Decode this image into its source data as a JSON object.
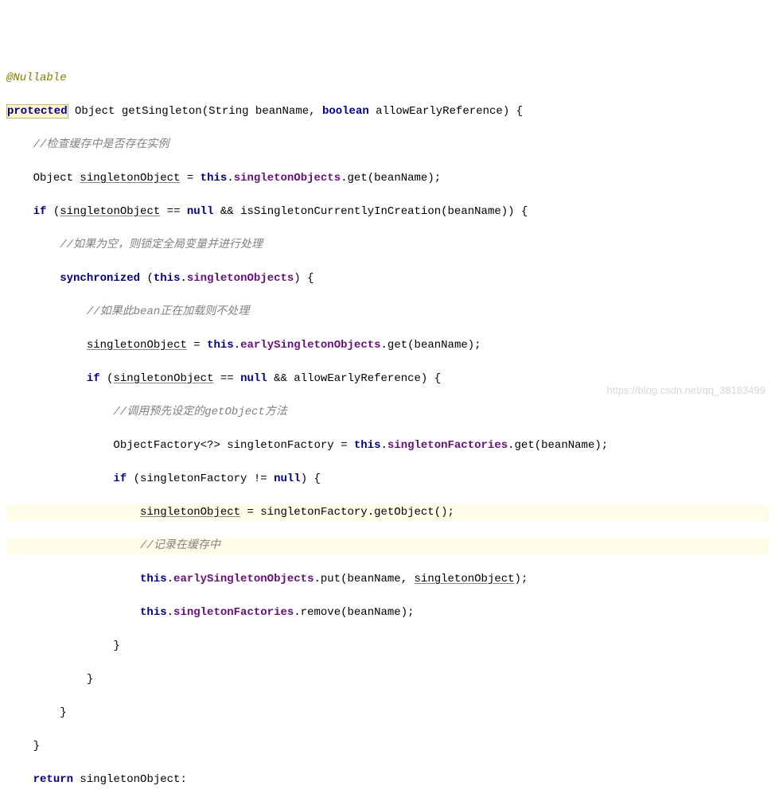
{
  "code": {
    "annotation": "@Nullable",
    "protected": "protected",
    "object": "Object",
    "method": "getSingleton",
    "param1_type": "String",
    "param1_name": "beanName",
    "boolean": "boolean",
    "param2_name": "allowEarlyReference",
    "comment1": "//检查缓存中是否存在实例",
    "line3_a": "Object ",
    "singletonObject": "singletonObject",
    "line3_b": " = ",
    "this": "this",
    "singletonObjects": "singletonObjects",
    "line3_c": ".get(beanName);",
    "if": "if",
    "line4_a": " (",
    "eq_null": " == ",
    "null": "null",
    "line4_b": " && isSingletonCurrentlyInCreation(beanName)) {",
    "comment2": "//如果为空，则锁定全局变量并进行处理",
    "synchronized": "synchronized",
    "line6_a": " (",
    "line6_b": ") {",
    "comment3": "//如果此",
    "comment3_italic": "bean",
    "comment3_b": "正在加载则不处理",
    "earlySingletonObjects": "earlySingletonObjects",
    "line9_a": " && allowEarlyReference) {",
    "comment4": "//调用预先设定的",
    "comment4_italic": "getObject",
    "comment4_b": "方法",
    "line11_a": "ObjectFactory<?> singletonFactory = ",
    "singletonFactories": "singletonFactories",
    "line12_a": " (singletonFactory != ",
    "line12_b": ") {",
    "line13_a": " = singletonFactory.getObject();",
    "comment5": "//记录在缓存中",
    "line15_a": ".put(beanName, ",
    "line15_b": ");",
    "line16_a": ".remove(beanName);",
    "return": "return",
    "line_return": " singletonObject:",
    "dot": ".",
    "close_brace": "}",
    "paren_open": "(",
    "comma_sp": ", ",
    "paren_close_brace": ") {"
  },
  "watermark": "https://blog.csdn.net/qq_38183499"
}
